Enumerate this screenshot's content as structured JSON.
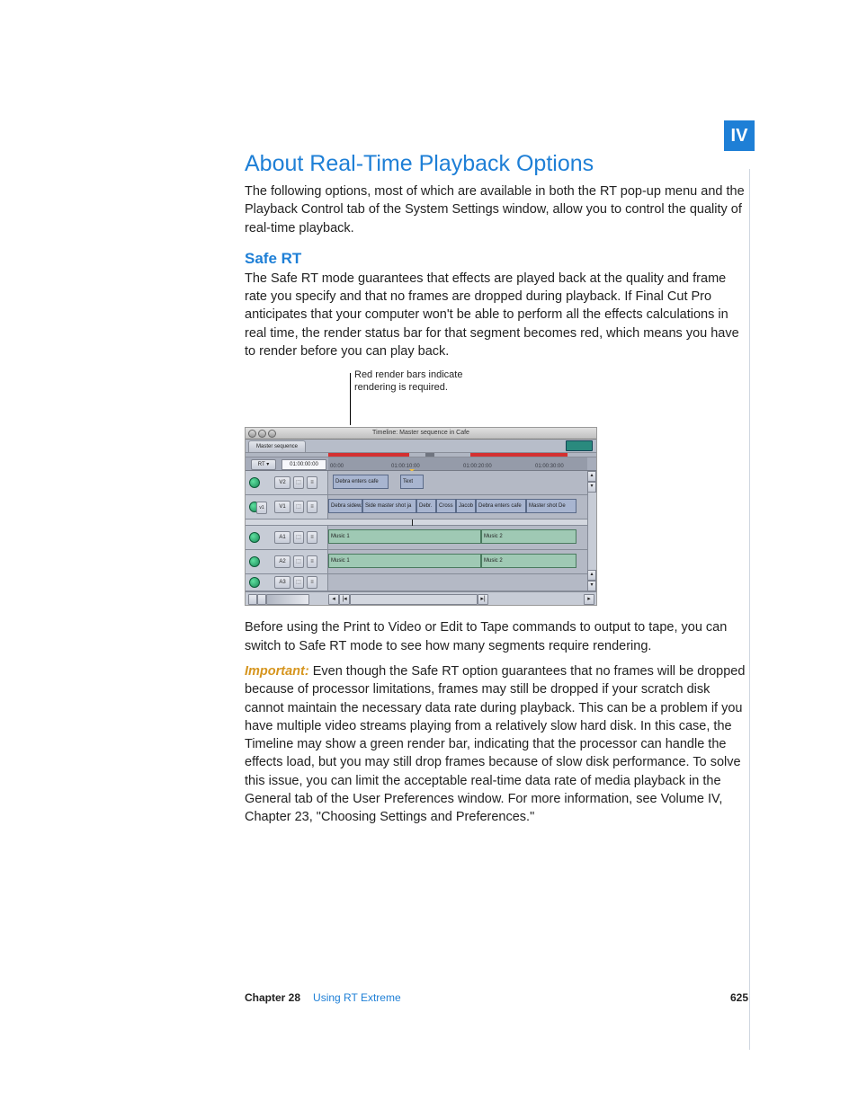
{
  "part_label": "IV",
  "heading": "About Real-Time Playback Options",
  "intro": "The following options, most of which are available in both the RT pop-up menu and the Playback Control tab of the System Settings window, allow you to control the quality of real-time playback.",
  "section_title": "Safe RT",
  "safe_rt_p1": "The Safe RT mode guarantees that effects are played back at the quality and frame rate you specify and that no frames are dropped during playback. If Final Cut Pro anticipates that your computer won't be able to perform all the effects calculations in real time, the render status bar for that segment becomes red, which means you have to render before you can play back.",
  "callout_l1": "Red render bars indicate",
  "callout_l2": "rendering is required.",
  "after_fig_p": "Before using the Print to Video or Edit to Tape commands to output to tape, you can switch to Safe RT mode to see how many segments require rendering.",
  "important_label": "Important:",
  "important_p": "  Even though the Safe RT option guarantees that no frames will be dropped because of processor limitations, frames may still be dropped if your scratch disk cannot maintain the necessary data rate during playback. This can be a problem if you have multiple video streams playing from a relatively slow hard disk. In this case, the Timeline may show a green render bar, indicating that the processor can handle the effects load, but you may still drop frames because of slow disk performance. To solve this issue, you can limit the acceptable real-time data rate of media playback in the General tab of the User Preferences window. For more information, see Volume IV, Chapter 23, \"Choosing Settings and Preferences.\"",
  "footer": {
    "chapter": "Chapter 28",
    "chapter_title": "Using RT Extreme",
    "page": "625"
  },
  "timeline": {
    "window_title": "Timeline: Master sequence in Cafe",
    "tab": "Master sequence",
    "rt_label": "RT ▾",
    "timecode": "01:00:00:00",
    "ruler": [
      "00:00",
      "01:00:10:00",
      "01:00:20:00",
      "01:00:30:00"
    ],
    "tracks": {
      "v2": "V2",
      "v1": "V1",
      "v1_dest": "v1",
      "a1": "A1",
      "a2": "A2",
      "a3": "A3"
    },
    "clips": {
      "v2a": "Debra enters cafe",
      "v2b": "Text",
      "v1a": "Debra sidew.",
      "v1b": "Side master shot ja",
      "v1c": "Debr.",
      "v1d": "Cross",
      "v1e": "Jacob",
      "v1f": "Debra enters cafe",
      "v1g": "Master shot De",
      "a1a": "Music 1",
      "a1b": "Music 2",
      "a2a": "Music 1",
      "a2b": "Music 2"
    }
  }
}
